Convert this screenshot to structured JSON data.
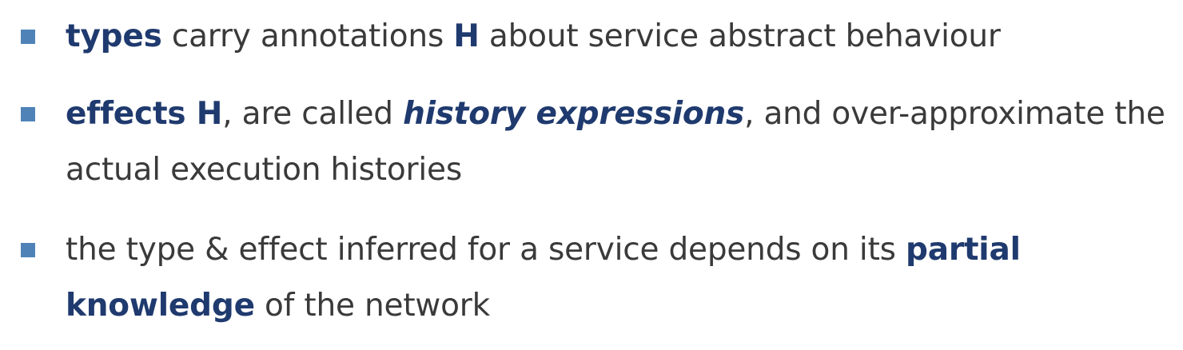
{
  "bullets": [
    {
      "lines": [
        [
          {
            "text": "types",
            "style": "bold"
          },
          {
            "text": " carry annotations ",
            "style": "normal"
          },
          {
            "text": "H",
            "style": "bold"
          },
          {
            "text": " about service abstract behaviour",
            "style": "normal"
          }
        ]
      ]
    },
    {
      "lines": [
        [
          {
            "text": "effects H",
            "style": "bold"
          },
          {
            "text": ", are called ",
            "style": "normal"
          },
          {
            "text": "history expressions",
            "style": "bold-italic"
          },
          {
            "text": ", and over-approximate the",
            "style": "normal"
          }
        ],
        [
          {
            "text": "actual execution histories",
            "style": "normal"
          }
        ]
      ]
    },
    {
      "lines": [
        [
          {
            "text": "the type & effect inferred for a service depends on its ",
            "style": "normal"
          },
          {
            "text": "partial",
            "style": "bold"
          }
        ],
        [
          {
            "text": "knowledge",
            "style": "bold"
          },
          {
            "text": " of the network",
            "style": "normal"
          }
        ]
      ]
    }
  ],
  "colors": {
    "emphasis": "#1f3a6e",
    "body_text": "#3a3a3a",
    "bullet_marker": "#4f83b8"
  }
}
